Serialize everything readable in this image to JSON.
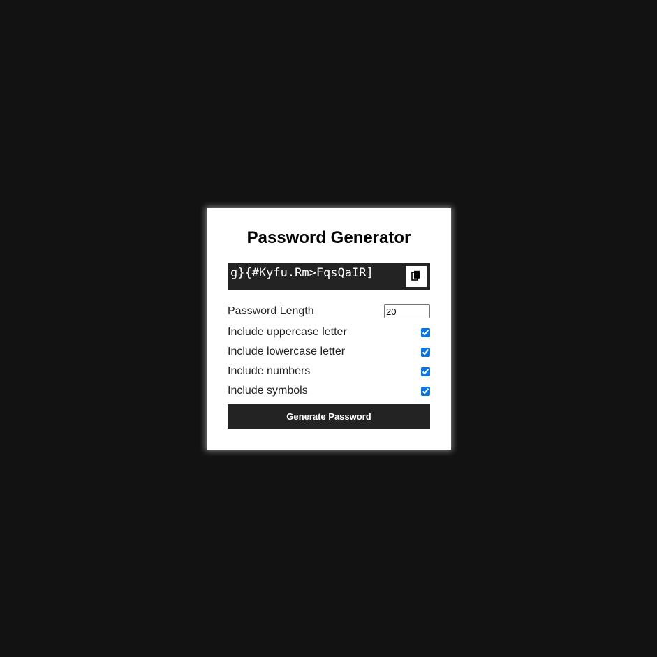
{
  "app": {
    "title": "Password Generator"
  },
  "result": {
    "password": "g}{#Kyfu.Rm>FqsQaIR]",
    "copy_icon": "clipboard-icon"
  },
  "options": {
    "length_label": "Password Length",
    "length_value": "20",
    "uppercase_label": "Include uppercase letter",
    "uppercase_checked": true,
    "lowercase_label": "Include lowercase letter",
    "lowercase_checked": true,
    "numbers_label": "Include numbers",
    "numbers_checked": true,
    "symbols_label": "Include symbols",
    "symbols_checked": true
  },
  "actions": {
    "generate_label": "Generate Password"
  },
  "colors": {
    "page_background": "#121212",
    "card_background": "#ffffff",
    "dark_accent": "#232323",
    "checkbox_accent": "#0b74de"
  }
}
